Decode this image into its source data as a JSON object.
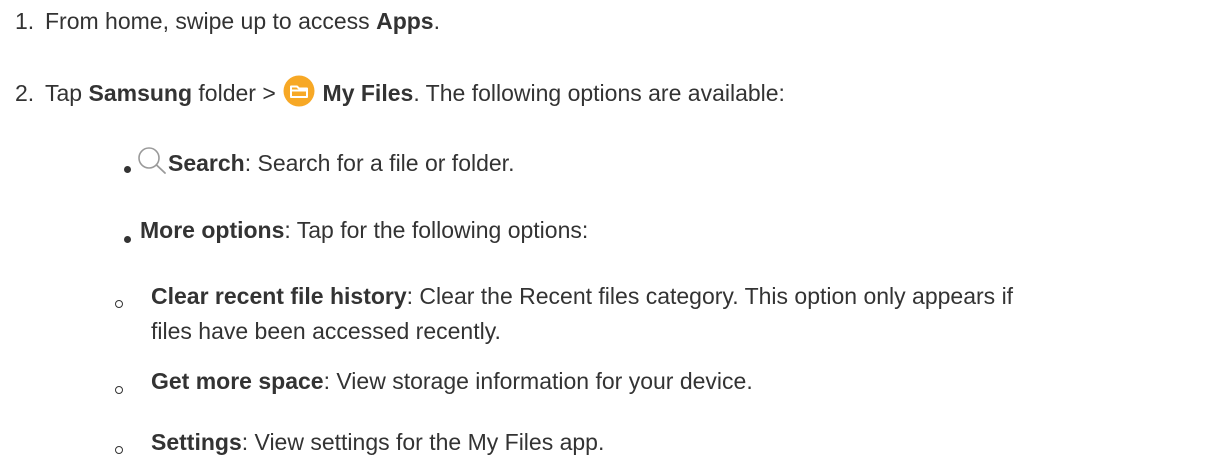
{
  "steps": [
    {
      "number": "1.",
      "pre": "From home, swipe up to access ",
      "bold": "Apps",
      "post": "."
    },
    {
      "number": "2.",
      "pre": "Tap ",
      "bold1": "Samsung",
      "mid": " folder > ",
      "icon": "my-files-folder-icon",
      "bold2": "My Files",
      "post": ". The following options are available:"
    }
  ],
  "options": [
    {
      "icon": "search-icon",
      "bold": "Search",
      "text": ": Search for a file or folder."
    },
    {
      "bold": "More options",
      "text": ": Tap for the following options:"
    }
  ],
  "sub_options": [
    {
      "bold": "Clear recent file history",
      "text": ": Clear the Recent files category. This option only appears if",
      "text_cont": "files have been accessed recently."
    },
    {
      "bold": "Get more space",
      "text": ": View storage information for your device."
    },
    {
      "bold": "Settings",
      "text": ": View settings for the My Files app."
    }
  ],
  "colors": {
    "text": "#333333",
    "folder_icon": "#f7a825",
    "search_icon": "#9a9a9a"
  }
}
